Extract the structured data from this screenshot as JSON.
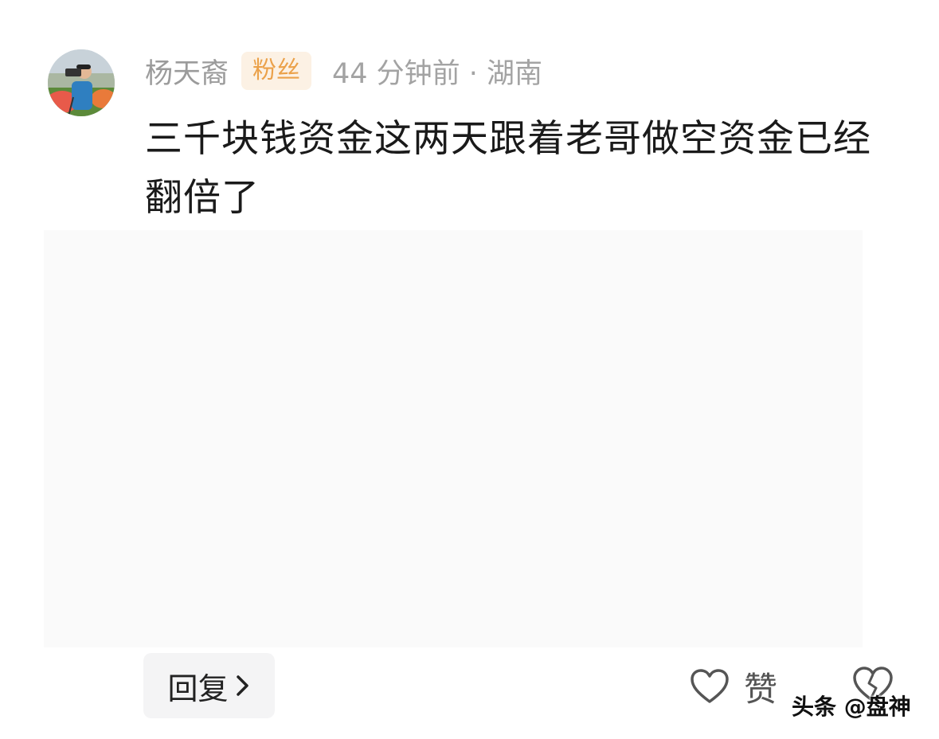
{
  "comment": {
    "username": "杨天裔",
    "badge": "粉丝",
    "time_location": "44 分钟前 · 湖南",
    "text": "三千块钱资金这两天跟着老哥做空资金已经翻倍了"
  },
  "actions": {
    "reply_label": "回复",
    "like_label": "赞"
  },
  "watermark": "头条 @盘神",
  "colors": {
    "badge_bg": "#fcf1e4",
    "badge_text": "#eba14a",
    "meta_text": "#9b9b9b",
    "body_text": "#1a1a1a"
  }
}
